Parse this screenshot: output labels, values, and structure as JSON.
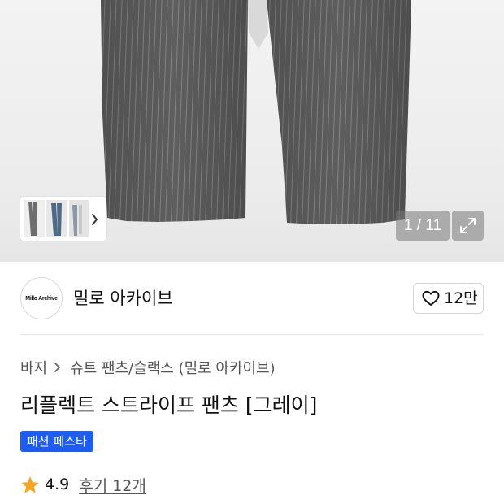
{
  "gallery": {
    "current_page": "1",
    "total_pages": "11",
    "counter_separator": " / ",
    "thumbnail_icon": "product-thumbnails",
    "next_icon": "chevron-right-icon",
    "expand_icon": "expand-icon"
  },
  "brand": {
    "logo_text": "Millo Archive",
    "name": "밀로 아카이브",
    "like_icon": "heart-outline-icon",
    "like_count": "12만"
  },
  "product": {
    "breadcrumb": [
      "바지",
      "슈트 팬츠/슬랙스 (밀로 아카이브)"
    ],
    "breadcrumb_separator_icon": "chevron-right-icon",
    "title": "리플렉트 스트라이프 팬츠 [그레이]",
    "event_badge": "패션 페스타",
    "rating": "4.9",
    "rating_icon": "star-icon",
    "review_label": "후기 12개"
  },
  "colors": {
    "accent_blue": "#1f5cf0",
    "star_orange": "#f5a623",
    "pants_gray": "#5b5b5b"
  }
}
